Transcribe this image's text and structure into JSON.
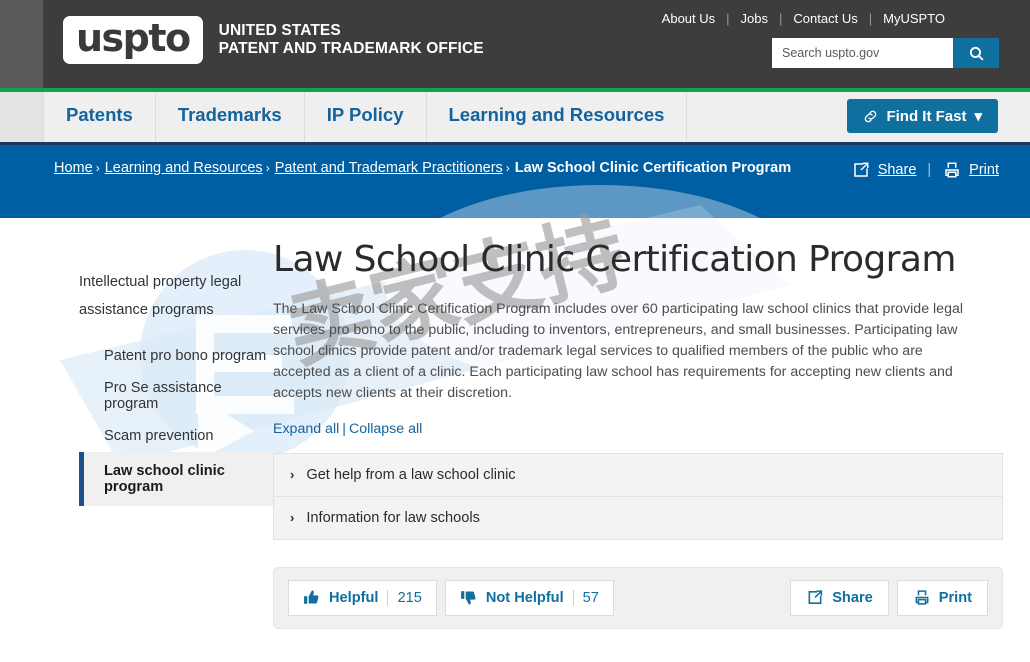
{
  "header": {
    "logo_text": "uspto",
    "agency_line1": "UNITED STATES",
    "agency_line2": "PATENT AND TRADEMARK OFFICE",
    "util_links": [
      "About Us",
      "Jobs",
      "Contact Us",
      "MyUSPTO"
    ],
    "separator": "|",
    "search": {
      "placeholder": "Search uspto.gov",
      "value": "",
      "button_icon": "search-icon"
    },
    "accent_green": "#15a04a",
    "background": "#3d3d3d"
  },
  "mainnav": {
    "items": [
      "Patents",
      "Trademarks",
      "IP Policy",
      "Learning and Resources"
    ],
    "find_it_fast": "Find It Fast",
    "find_it_fast_icon": "link-icon",
    "caret": "▾",
    "link_color": "#15639c",
    "button_color": "#0f6f9e"
  },
  "breadcrumb": {
    "items": [
      {
        "label": "Home",
        "current": false
      },
      {
        "label": "Learning and Resources",
        "current": false
      },
      {
        "label": "Patent and Trademark Practitioners",
        "current": false
      },
      {
        "label": "Law School Clinic Certification Program",
        "current": true
      }
    ],
    "separator": "›",
    "share_label": "Share",
    "print_label": "Print",
    "divider": "|",
    "band_color": "#005ea2"
  },
  "sidebar": {
    "parent": "Intellectual property legal assistance programs",
    "items": [
      {
        "label": "Patent pro bono program",
        "active": false
      },
      {
        "label": "Pro Se assistance program",
        "active": false
      },
      {
        "label": "Scam prevention",
        "active": false
      },
      {
        "label": "Law school clinic program",
        "active": true
      }
    ],
    "active_border_color": "#1b4f8a"
  },
  "main": {
    "title": "Law School Clinic Certification Program",
    "intro": "The Law School Clinic Certification Program includes over 60 participating law school clinics that provide legal services pro bono to the public, including to inventors, entrepreneurs, and small businesses. Participating law school clinics provide patent and/or trademark legal services to qualified members of the public who are accepted as a client of a clinic. Each participating law school has requirements for accepting new clients and accepts new clients at their discretion.",
    "expand_all": "Expand all",
    "collapse_all": "Collapse all",
    "expand_divider": "|",
    "accordions": [
      {
        "label": "Get help from a law school clinic",
        "expanded": false
      },
      {
        "label": "Information for law schools",
        "expanded": false
      }
    ],
    "chevron": "›"
  },
  "feedback": {
    "helpful_label": "Helpful",
    "helpful_count": "215",
    "not_helpful_label": "Not Helpful",
    "not_helpful_count": "57",
    "share_label": "Share",
    "print_label": "Print",
    "accent": "#0f6f9e"
  },
  "watermark": {
    "text": "卖家支持",
    "text_color": "#9a9a9a",
    "shape_color": "#cfe3f5"
  }
}
